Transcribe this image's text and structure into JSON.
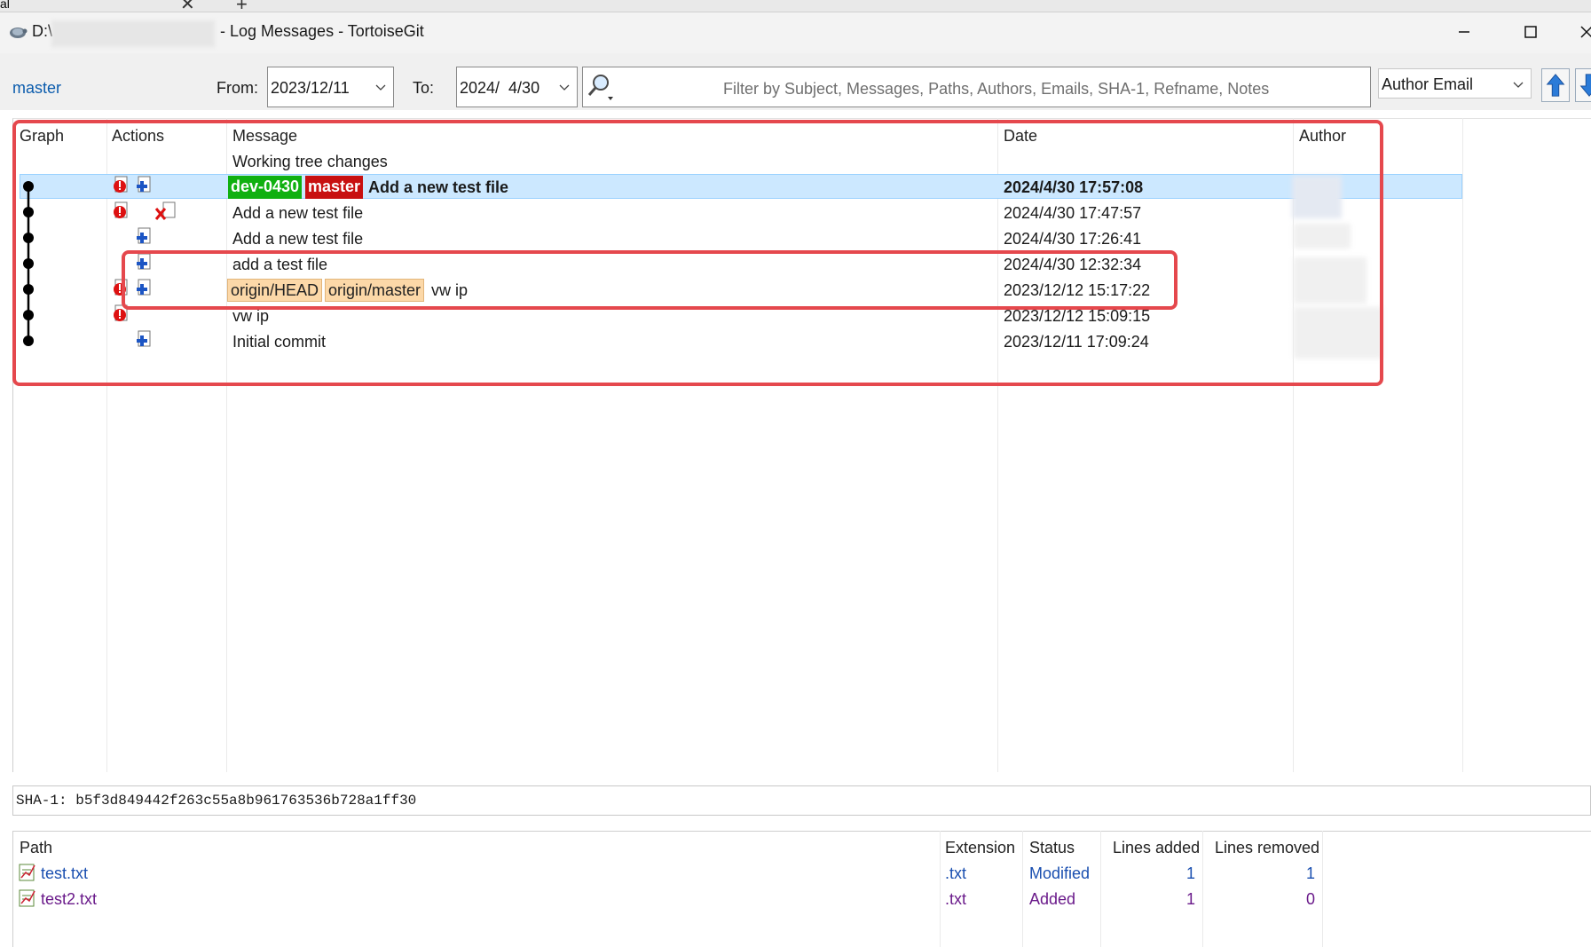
{
  "browser_tabs": {
    "tab_fragment": "al",
    "close_symbol": "✕",
    "new_symbol": "+"
  },
  "window": {
    "title_drive": "D:\\",
    "title_rest": "- Log Messages - TortoiseGit"
  },
  "toolbar": {
    "branch": "master",
    "from_label": "From:",
    "from_value": "2023/12/11",
    "to_label": "To:",
    "to_value": "2024/  4/30",
    "filter_placeholder": "Filter by Subject, Messages, Paths, Authors, Emails, SHA-1, Refname, Notes",
    "filter_field": "Author Email"
  },
  "log": {
    "columns": [
      "Graph",
      "Actions",
      "Message",
      "Date",
      "Author"
    ],
    "working_tree": "Working tree changes",
    "rows": [
      {
        "refs": [
          "dev-0430",
          "master"
        ],
        "message": "Add a new test file",
        "date": "2024/4/30 17:57:08",
        "selected": true
      },
      {
        "refs": [],
        "message": "Add a new test file",
        "date": "2024/4/30 17:47:57"
      },
      {
        "refs": [],
        "message": "Add a new test file",
        "date": "2024/4/30 17:26:41"
      },
      {
        "refs": [],
        "message": "add a test file",
        "date": "2024/4/30 12:32:34"
      },
      {
        "refs": [
          "origin/HEAD",
          "origin/master"
        ],
        "message": "vw ip",
        "date": "2023/12/12 15:17:22"
      },
      {
        "refs": [],
        "message": "vw ip",
        "date": "2023/12/12 15:09:15"
      },
      {
        "refs": [],
        "message": "Initial commit",
        "date": "2023/12/11 17:09:24"
      }
    ]
  },
  "sha": "SHA-1: b5f3d849442f263c55a8b961763536b728a1ff30",
  "files": {
    "columns": [
      "Path",
      "Extension",
      "Status",
      "Lines added",
      "Lines removed"
    ],
    "rows": [
      {
        "path": "test.txt",
        "ext": ".txt",
        "status": "Modified",
        "added": "1",
        "removed": "1"
      },
      {
        "path": "test2.txt",
        "ext": ".txt",
        "status": "Added",
        "added": "1",
        "removed": "0"
      }
    ]
  },
  "colors": {
    "accent_link": "#0b5cad",
    "selection": "#cce8ff",
    "annotation": "#e5484d",
    "ref_local": "#10b010",
    "ref_head": "#c81010",
    "ref_remote": "#fcd8a8"
  }
}
